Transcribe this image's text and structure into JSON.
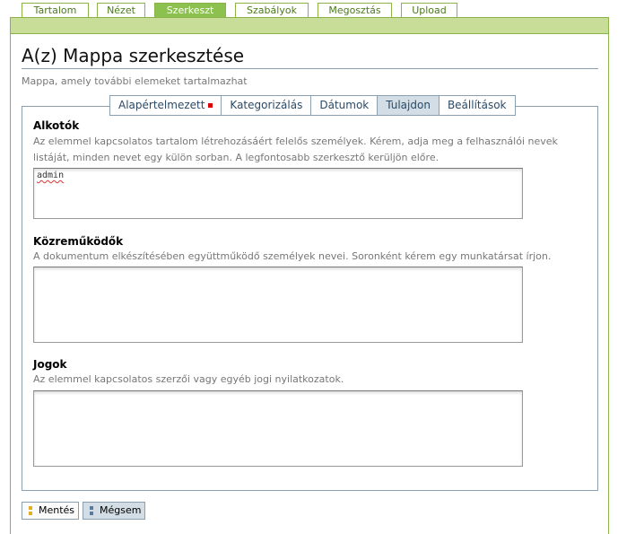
{
  "tabs": [
    {
      "label": "Tartalom"
    },
    {
      "label": "Nézet"
    },
    {
      "label": "Szerkeszt"
    },
    {
      "label": "Szabályok"
    },
    {
      "label": "Megosztás"
    },
    {
      "label": "Upload"
    }
  ],
  "page": {
    "title": "A(z) Mappa szerkesztése",
    "description": "Mappa, amely további elemeket tartalmazhat"
  },
  "subtabs": [
    {
      "label": "Alapértelmezett"
    },
    {
      "label": "Kategorizálás"
    },
    {
      "label": "Dátumok"
    },
    {
      "label": "Tulajdon"
    },
    {
      "label": "Beállítások"
    }
  ],
  "fields": {
    "creators": {
      "label": "Alkotók",
      "help": "Az elemmel kapcsolatos tartalom létrehozásáért felelős személyek. Kérem, adja meg a felhasználói nevek listáját, minden nevet egy külön sorban. A legfontosabb szerkesztő kerüljön előre.",
      "value": "admin"
    },
    "contributors": {
      "label": "Közreműködők",
      "help": "A dokumentum elkészítésében együttműködő személyek nevei. Soronként kérem egy munkatársat írjon.",
      "value": ""
    },
    "rights": {
      "label": "Jogok",
      "help": "Az elemmel kapcsolatos szerzői vagy egyéb jogi nyilatkozatok.",
      "value": ""
    }
  },
  "buttons": {
    "save": "Mentés",
    "cancel": "Mégsem"
  },
  "colors": {
    "tab_border": "#8cb34a",
    "tab_active": "#8cc14f",
    "green_bar": "#c8de98",
    "subtab_active": "#d2dde6",
    "required_marker": "#dd0000"
  }
}
